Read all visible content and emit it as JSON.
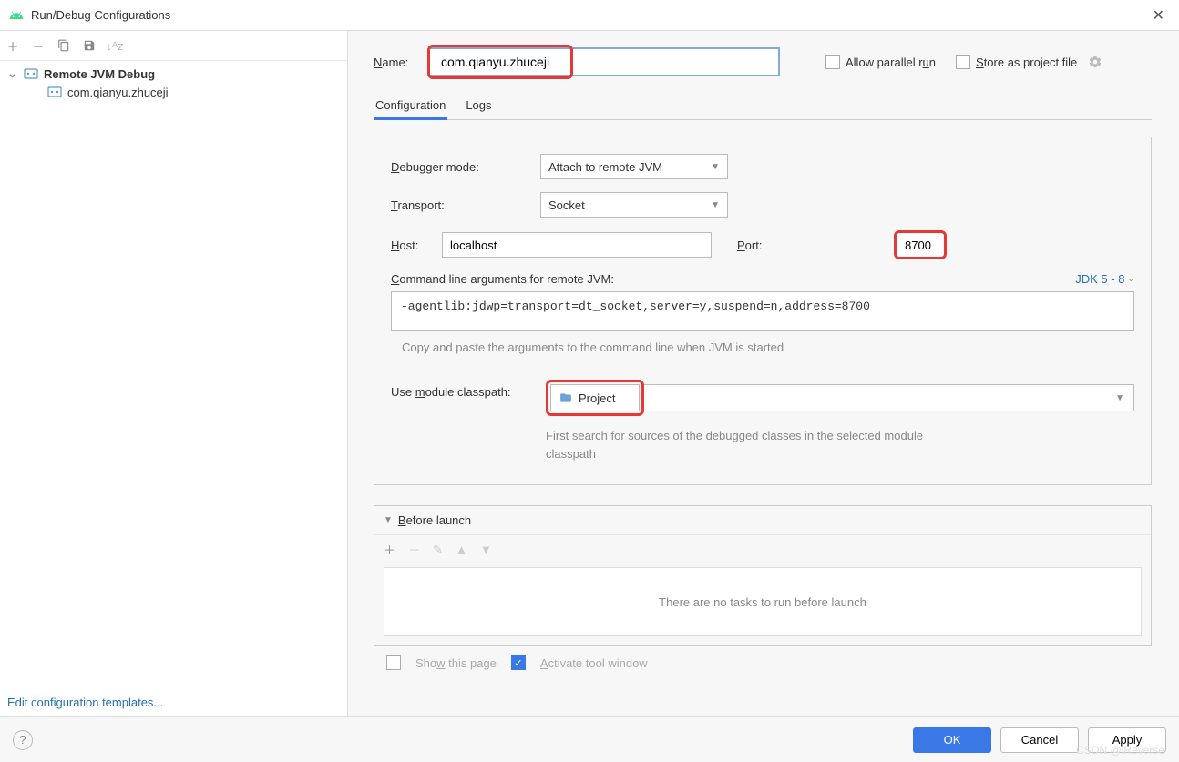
{
  "window": {
    "title": "Run/Debug Configurations"
  },
  "sidebar": {
    "root_label": "Remote JVM Debug",
    "child_label": "com.qianyu.zhuceji",
    "edit_templates": "Edit configuration templates..."
  },
  "form": {
    "name_label": "Name:",
    "name_value": "com.qianyu.zhuceji",
    "allow_parallel": "Allow parallel run",
    "store_as_project": "Store as project file"
  },
  "tabs": {
    "configuration": "Configuration",
    "logs": "Logs"
  },
  "config": {
    "debugger_mode_label": "Debugger mode:",
    "debugger_mode_value": "Attach to remote JVM",
    "transport_label": "Transport:",
    "transport_value": "Socket",
    "host_label": "Host:",
    "host_value": "localhost",
    "port_label": "Port:",
    "port_value": "8700",
    "cmdline_label": "Command line arguments for remote JVM:",
    "jdk_label": "JDK 5 - 8",
    "cmdline_value": "-agentlib:jdwp=transport=dt_socket,server=y,suspend=n,address=8700",
    "cmdline_hint": "Copy and paste the arguments to the command line when JVM is started",
    "module_label": "Use module classpath:",
    "module_value": "Project",
    "module_hint": "First search for sources of the debugged classes in the selected module classpath"
  },
  "before_launch": {
    "title": "Before launch",
    "empty": "There are no tasks to run before launch",
    "show_page": "Show this page",
    "activate_window": "Activate tool window"
  },
  "footer": {
    "ok": "OK",
    "cancel": "Cancel",
    "apply": "Apply"
  },
  "watermark": "CSDN @iReverse"
}
